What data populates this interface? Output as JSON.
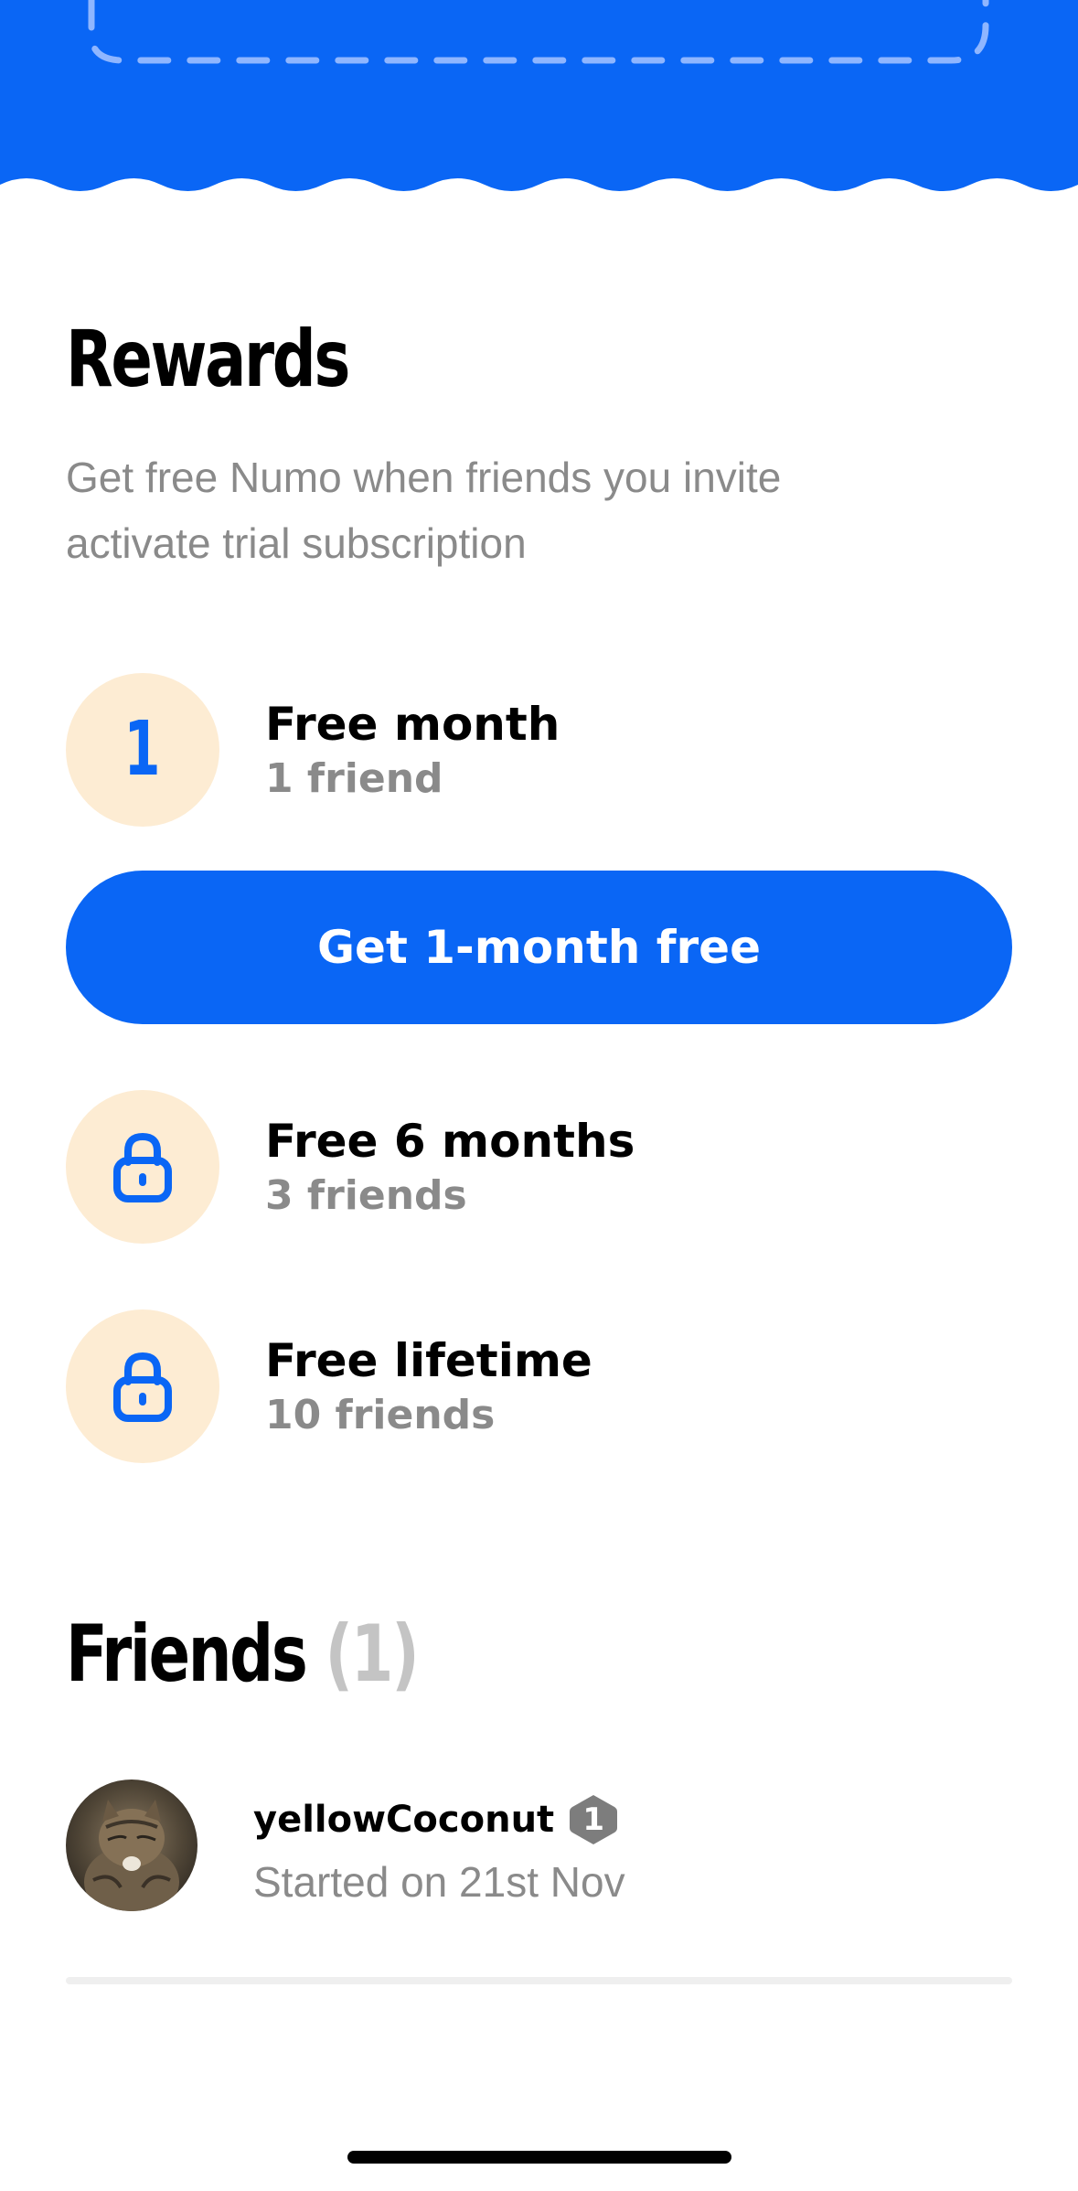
{
  "colors": {
    "brand_blue": "#0a66f5",
    "badge_background": "#fdecd3",
    "muted_text": "#8a8a8a",
    "friend_count_gray": "#c4c4c4",
    "level_badge_gray": "#7d7d7d"
  },
  "rewards": {
    "title": "Rewards",
    "subtitle": "Get free Numo when friends you invite activate trial subscription",
    "items": [
      {
        "badge_number": "1",
        "title": "Free month",
        "requirement": "1 friend",
        "icon": null
      },
      {
        "badge_number": null,
        "title": "Free 6 months",
        "requirement": "3 friends",
        "icon": "lock-icon"
      },
      {
        "badge_number": null,
        "title": "Free lifetime",
        "requirement": "10 friends",
        "icon": "lock-icon"
      }
    ],
    "cta_label": "Get 1-month free"
  },
  "friends": {
    "title": "Friends",
    "count_label": "(1)",
    "list": [
      {
        "username": "yellowCoconut",
        "level": "1",
        "started": "Started on 21st Nov",
        "avatar": "cat-avatar"
      }
    ]
  }
}
